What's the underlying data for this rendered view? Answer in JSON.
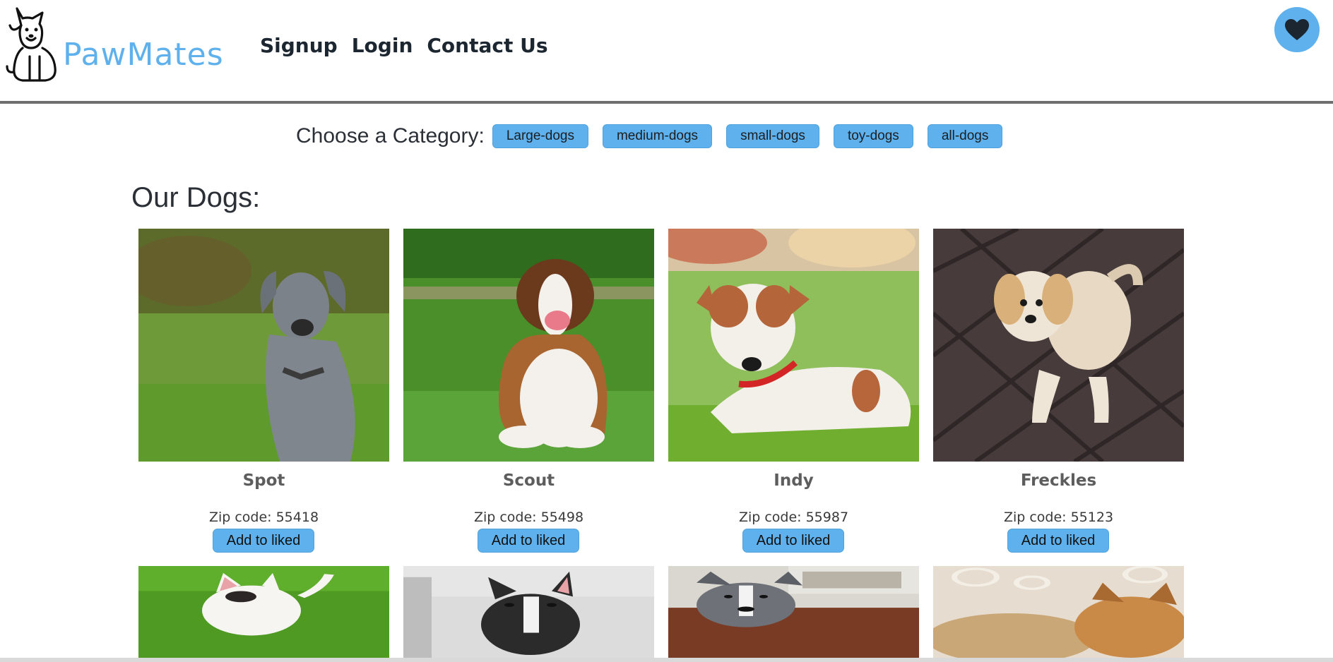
{
  "brand": {
    "name": "PawMates",
    "color": "#5eb1ec"
  },
  "nav": {
    "signup": "Signup",
    "login": "Login",
    "contact": "Contact Us"
  },
  "liked": {
    "icon": "heart-icon"
  },
  "categories": {
    "label": "Choose a Category:",
    "items": [
      "Large-dogs",
      "medium-dogs",
      "small-dogs",
      "toy-dogs",
      "all-dogs"
    ]
  },
  "dogs_title": "Our Dogs:",
  "dogs": [
    {
      "name": "Spot",
      "zip": "Zip code: 55418",
      "button": "Add to liked"
    },
    {
      "name": "Scout",
      "zip": "Zip code: 55498",
      "button": "Add to liked"
    },
    {
      "name": "Indy",
      "zip": "Zip code: 55987",
      "button": "Add to liked"
    },
    {
      "name": "Freckles",
      "zip": "Zip code: 55123",
      "button": "Add to liked"
    }
  ],
  "colors": {
    "accent": "#5eb1ec",
    "divider": "#6e6e6e",
    "text": "#2b2f36"
  }
}
